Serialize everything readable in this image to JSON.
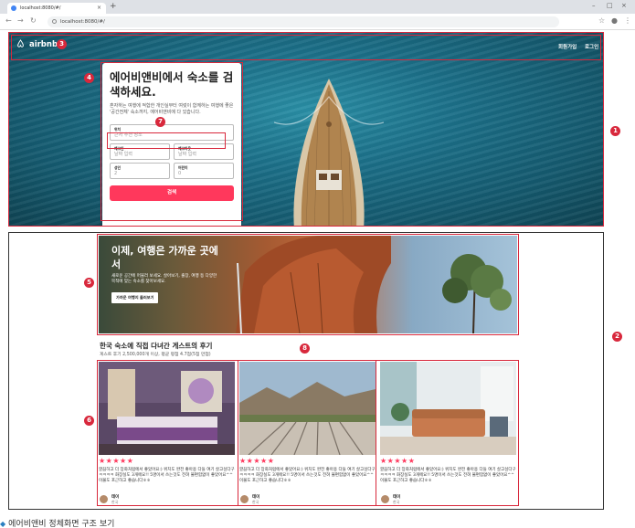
{
  "browser": {
    "tab_title": "localhost:8080/#/",
    "new_tab": "+",
    "url": "localhost:8080/#/",
    "minimize": "–",
    "maximize": "□",
    "close": "×"
  },
  "nav": {
    "logo": "airbnb",
    "signup": "회원가입",
    "login": "로그인"
  },
  "search": {
    "title": "에어비앤비에서 숙소를 검색하세요.",
    "description": "혼자하는 여행에 적합한 개인실부터 여럿이 함께하는 여행에 좋은 '공간전체' 숙소까지, 에어비앤비에 다 있습니다.",
    "location_label": "위치",
    "location_placeholder": "근처 추천 장소",
    "checkin_label": "체크인",
    "checkin_placeholder": "날짜 입력",
    "checkout_label": "체크아웃",
    "checkout_placeholder": "날짜 입력",
    "adults_label": "성인",
    "adults_value": "2",
    "children_label": "어린이",
    "children_value": "0",
    "button": "검색"
  },
  "promo": {
    "title": "이제, 여행은 가까운 곳에서",
    "description": "새로운 공간에 머물러 보세요. 살아보기, 출장, 여행 등 다양한 목적에 맞는 숙소를 찾아보세요.",
    "button": "가까운 여행지 둘러보기"
  },
  "reviews": {
    "title": "한국 숙소에 직접 다녀간 게스트의 후기",
    "subtitle": "게스트 후기 2,500,000개 이상, 평균 평점 4.7점(5점 만점)",
    "cards": [
      {
        "stars": "★★★★★",
        "text": "깔끔하고 더 장화처럼에서 좋았어요:) 위치도 완전 좋아용 다들 여기 살고싶다구ㅋㅋㅋㅋ 화장실도 3개에요!! 5명이서 쓰는것도 전혀 불편함없이 좋았어요^^ 이불도 포근하고 좋습니다ㅎㅎ",
        "author": "테이",
        "country": "한국"
      },
      {
        "stars": "★★★★★",
        "text": "깔끔하고 더 장화처럼에서 좋았어요:) 위치도 완전 좋아용 다들 여기 살고싶다구ㅋㅋㅋㅋ 화장실도 3개에요!! 5명이서 쓰는것도 전혀 불편함없이 좋았어요^^ 이불도 포근하고 좋습니다ㅎㅎ",
        "author": "테이",
        "country": "한국"
      },
      {
        "stars": "★★★★★",
        "text": "깔끔하고 더 장화처럼에서 좋았어요:) 위치도 완전 좋아용 다들 여기 살고싶다구ㅋㅋㅋㅋ 화장실도 3개에요!! 5명이서 쓰는것도 전혀 불편함없이 좋았어요^^ 이불도 포근하고 좋습니다ㅎㅎ",
        "author": "테이",
        "country": "한국"
      }
    ]
  },
  "annotations": [
    "1",
    "2",
    "3",
    "4",
    "5",
    "6",
    "7",
    "8"
  ],
  "caption": "에어비앤비 정체화면 구조 보기",
  "caption_mark": "◆",
  "colors": {
    "accent": "#ff385c",
    "annotation": "#d8283c",
    "ocean": "#1c7089"
  }
}
